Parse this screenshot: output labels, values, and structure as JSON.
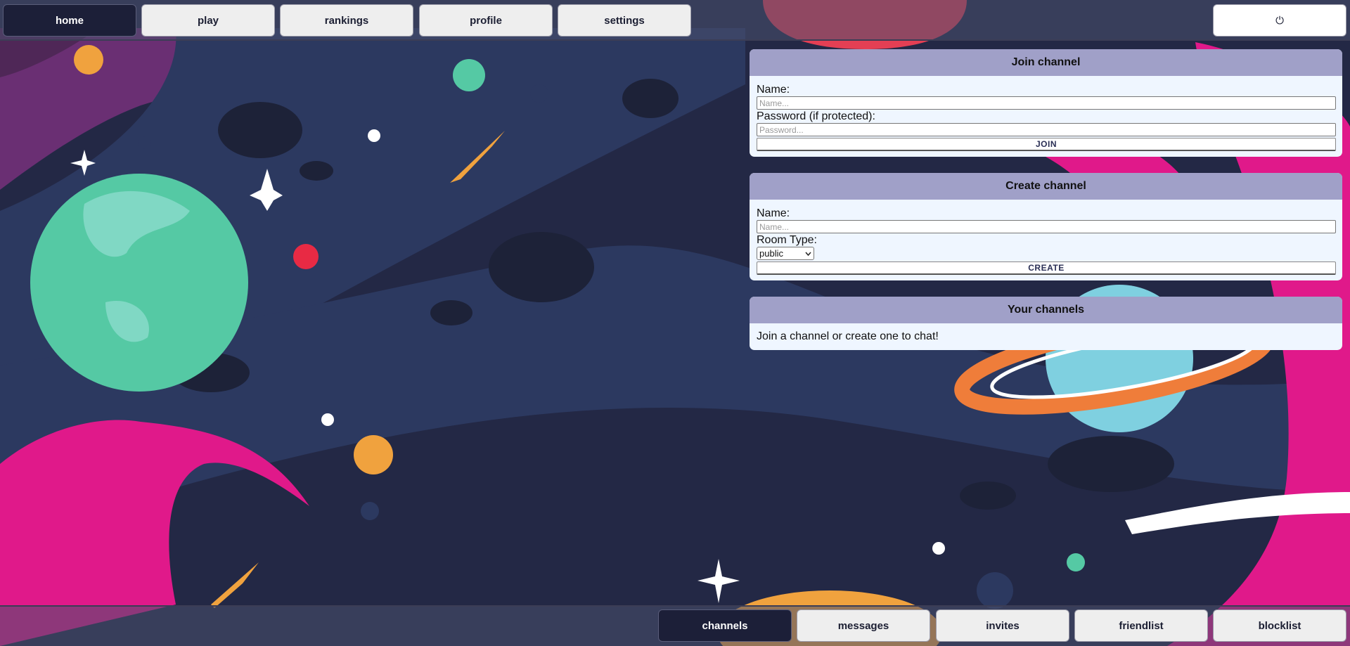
{
  "nav": {
    "items": [
      {
        "label": "home",
        "active": true
      },
      {
        "label": "play",
        "active": false
      },
      {
        "label": "rankings",
        "active": false
      },
      {
        "label": "profile",
        "active": false
      },
      {
        "label": "settings",
        "active": false
      }
    ],
    "power_glyph": "⏻"
  },
  "join_channel": {
    "title": "Join channel",
    "name_label": "Name:",
    "name_placeholder": "Name...",
    "password_label": "Password (if protected):",
    "password_placeholder": "Password...",
    "button": "JOIN"
  },
  "create_channel": {
    "title": "Create channel",
    "name_label": "Name:",
    "name_placeholder": "Name...",
    "room_type_label": "Room Type:",
    "room_type_value": "public",
    "button": "CREATE"
  },
  "your_channels": {
    "title": "Your channels",
    "empty_message": "Join a channel or create one to chat!"
  },
  "bottom_nav": {
    "items": [
      {
        "label": "channels",
        "active": true
      },
      {
        "label": "messages",
        "active": false
      },
      {
        "label": "invites",
        "active": false
      },
      {
        "label": "friendlist",
        "active": false
      },
      {
        "label": "blocklist",
        "active": false
      }
    ]
  },
  "colors": {
    "background": "#232845",
    "active_button": "#1c1f38",
    "panel_header": "#a0a0c8",
    "panel_body": "#eff6ff",
    "accent_pink": "#e0198a",
    "accent_green": "#55c9a4",
    "accent_orange": "#f0a23e"
  }
}
